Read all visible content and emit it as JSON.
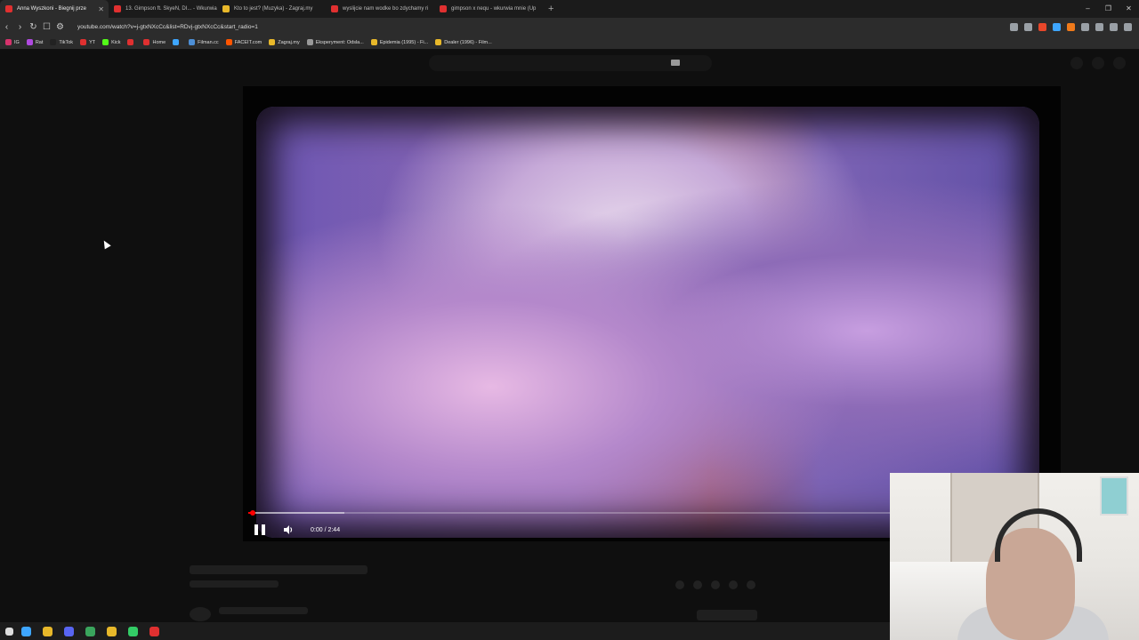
{
  "browser": {
    "tabs": [
      {
        "label": "Anna Wyszkoni - Biegnij prze",
        "color": "#e03030",
        "active": true
      },
      {
        "label": "13. Gimpson ft. SkyeN, DI... - Wkurwia",
        "color": "#e03030"
      },
      {
        "label": "Kto to jest? (Muzyka) - Zagraj.my",
        "color": "#e8b82a"
      },
      {
        "label": "wyslijcie nam wodke bo zdychamy ri",
        "color": "#e03030"
      },
      {
        "label": "gimpson x nequ - wkurwia mnie (Up",
        "color": "#e03030"
      }
    ],
    "close_glyph": "✕",
    "new_tab_glyph": "+",
    "window_controls": {
      "minimize": "–",
      "maximize": "❐",
      "close": "✕"
    },
    "nav": {
      "back": "‹",
      "forward": "›",
      "reload": "↻",
      "bookmark": "☐",
      "info": "⚙"
    },
    "url": "youtube.com/watch?v=j-gtxNXcCc&list=RDvj-gtxNXcCc&start_radio=1",
    "bookmarks": [
      {
        "label": "IG",
        "color": "#d6336c"
      },
      {
        "label": "Rat",
        "color": "#b04ae0"
      },
      {
        "label": "TikTok",
        "color": "#222222"
      },
      {
        "label": "YT",
        "color": "#e03030"
      },
      {
        "label": "Kick",
        "color": "#53fc18"
      },
      {
        "label": "",
        "color": "#e03030"
      },
      {
        "label": "Home",
        "color": "#e03030"
      },
      {
        "label": "",
        "color": "#3ea6ff"
      },
      {
        "label": "Filman.cc",
        "color": "#4d8fd6"
      },
      {
        "label": "FACEIT.com",
        "color": "#ff5500"
      },
      {
        "label": "Zagraj.my",
        "color": "#e8b82a"
      },
      {
        "label": "Eksperyment: Odsla...",
        "color": "#999999"
      },
      {
        "label": "Epidemia (1995) - Fi...",
        "color": "#e8b82a"
      },
      {
        "label": "Dealer (1996) - Film...",
        "color": "#e8b82a"
      }
    ],
    "extension_colors": [
      "#9aa0a6",
      "#9aa0a6",
      "#e8472a",
      "#3ea6ff",
      "#f07a1a",
      "#9aa0a6",
      "#9aa0a6",
      "#9aa0a6",
      "#9aa0a6"
    ]
  },
  "player": {
    "time": "0:00 / 2:44",
    "progress_played": 0.005,
    "progress_buffered": 0.12,
    "state": "playing"
  },
  "taskbar_icon_colors": [
    "#3ea6ff",
    "#e8b82a",
    "#5865f2",
    "#3aa55d",
    "#e8b82a",
    "#33cc66",
    "#e03030"
  ]
}
